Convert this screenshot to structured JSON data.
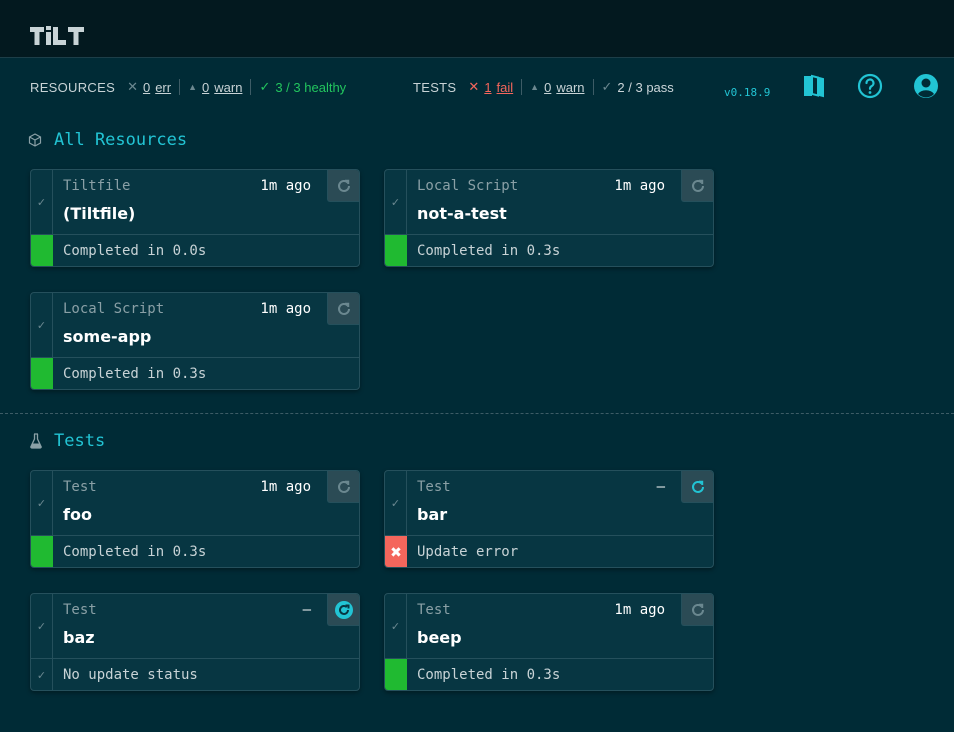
{
  "header": {
    "logo_text": "TILT"
  },
  "statusbar": {
    "resources": {
      "label": "RESOURCES",
      "err_count": "0",
      "err_label": "err",
      "warn_count": "0",
      "warn_label": "warn",
      "healthy_text": "3 / 3 healthy"
    },
    "tests": {
      "label": "TESTS",
      "fail_count": "1",
      "fail_label": "fail",
      "warn_count": "0",
      "warn_label": "warn",
      "pass_text": "2 / 3 pass"
    },
    "version": "v0.18.9"
  },
  "sections": {
    "resources": {
      "title": "All Resources"
    },
    "tests": {
      "title": "Tests"
    }
  },
  "cards": [
    {
      "kind": "Tiltfile",
      "name": "(Tiltfile)",
      "ago": "1m ago",
      "status": "Completed in 0.0s",
      "state": "ok"
    },
    {
      "kind": "Local Script",
      "name": "not-a-test",
      "ago": "1m ago",
      "status": "Completed in 0.3s",
      "state": "ok"
    },
    {
      "kind": "Local Script",
      "name": "some-app",
      "ago": "1m ago",
      "status": "Completed in 0.3s",
      "state": "ok"
    },
    {
      "kind": "Test",
      "name": "foo",
      "ago": "1m ago",
      "status": "Completed in 0.3s",
      "state": "ok"
    },
    {
      "kind": "Test",
      "name": "bar",
      "ago": "–",
      "status": "Update error",
      "state": "error"
    },
    {
      "kind": "Test",
      "name": "baz",
      "ago": "–",
      "status": "No update status",
      "state": "none"
    },
    {
      "kind": "Test",
      "name": "beep",
      "ago": "1m ago",
      "status": "Completed in 0.3s",
      "state": "ok"
    }
  ],
  "colors": {
    "background": "#002b36",
    "card": "#073642",
    "accent": "#22c4d4",
    "ok": "#20ba31",
    "error": "#f4665c"
  },
  "icons": {
    "docs": "book-icon",
    "help": "help-circle-icon",
    "account": "user-circle-icon",
    "trigger": "refresh-icon",
    "resources": "cube-icon",
    "tests": "flask-icon"
  }
}
